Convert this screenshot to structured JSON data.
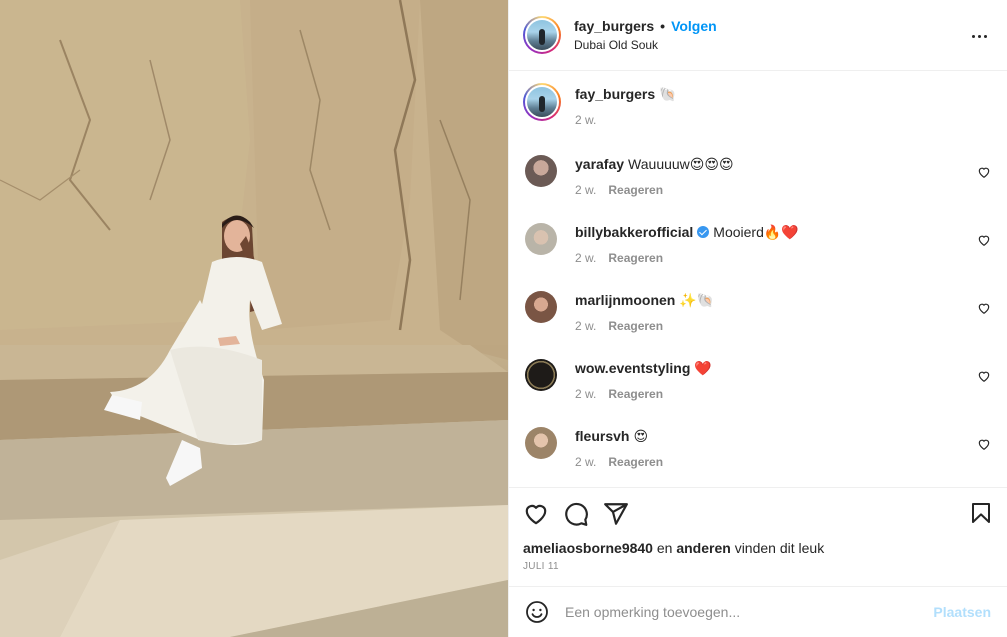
{
  "header": {
    "username": "fay_burgers",
    "separator": "•",
    "follow_label": "Volgen",
    "location": "Dubai Old Souk"
  },
  "caption": {
    "username": "fay_burgers",
    "text": "🐚",
    "time": "2 w."
  },
  "comments": [
    {
      "username": "yarafay",
      "text": "Wauuuuw😍😍😍",
      "time": "2 w.",
      "reply": "Reageren",
      "verified": false,
      "avatar_color": "#6b5a55"
    },
    {
      "username": "billybakkerofficial",
      "text": "Mooierd🔥❤️",
      "time": "2 w.",
      "reply": "Reageren",
      "verified": true,
      "avatar_color": "#b9b4a8"
    },
    {
      "username": "marlijnmoonen",
      "text": "✨🐚",
      "time": "2 w.",
      "reply": "Reageren",
      "verified": false,
      "avatar_color": "#7a5544"
    },
    {
      "username": "wow.eventstyling",
      "text": "❤️",
      "time": "2 w.",
      "reply": "Reageren",
      "verified": false,
      "avatar_color": "#1e1b18"
    },
    {
      "username": "fleursvh",
      "text": "😍",
      "time": "2 w.",
      "reply": "Reageren",
      "verified": false,
      "avatar_color": "#9c8468"
    }
  ],
  "likes": {
    "user": "ameliaosborne9840",
    "connector": "en",
    "others": "anderen",
    "suffix": "vinden dit leuk"
  },
  "date": "JULI 11",
  "add_comment": {
    "placeholder": "Een opmerking toevoegen...",
    "post_label": "Plaatsen"
  },
  "colors": {
    "accent": "#0095f6",
    "post_disabled": "#b2dffc",
    "muted": "#8e8e8e",
    "like_red": "#ed4956"
  },
  "icons": {
    "more": "more-horizontal-icon",
    "like": "heart-icon",
    "comment": "comment-icon",
    "share": "send-icon",
    "save": "bookmark-icon",
    "emoji": "emoji-icon"
  }
}
